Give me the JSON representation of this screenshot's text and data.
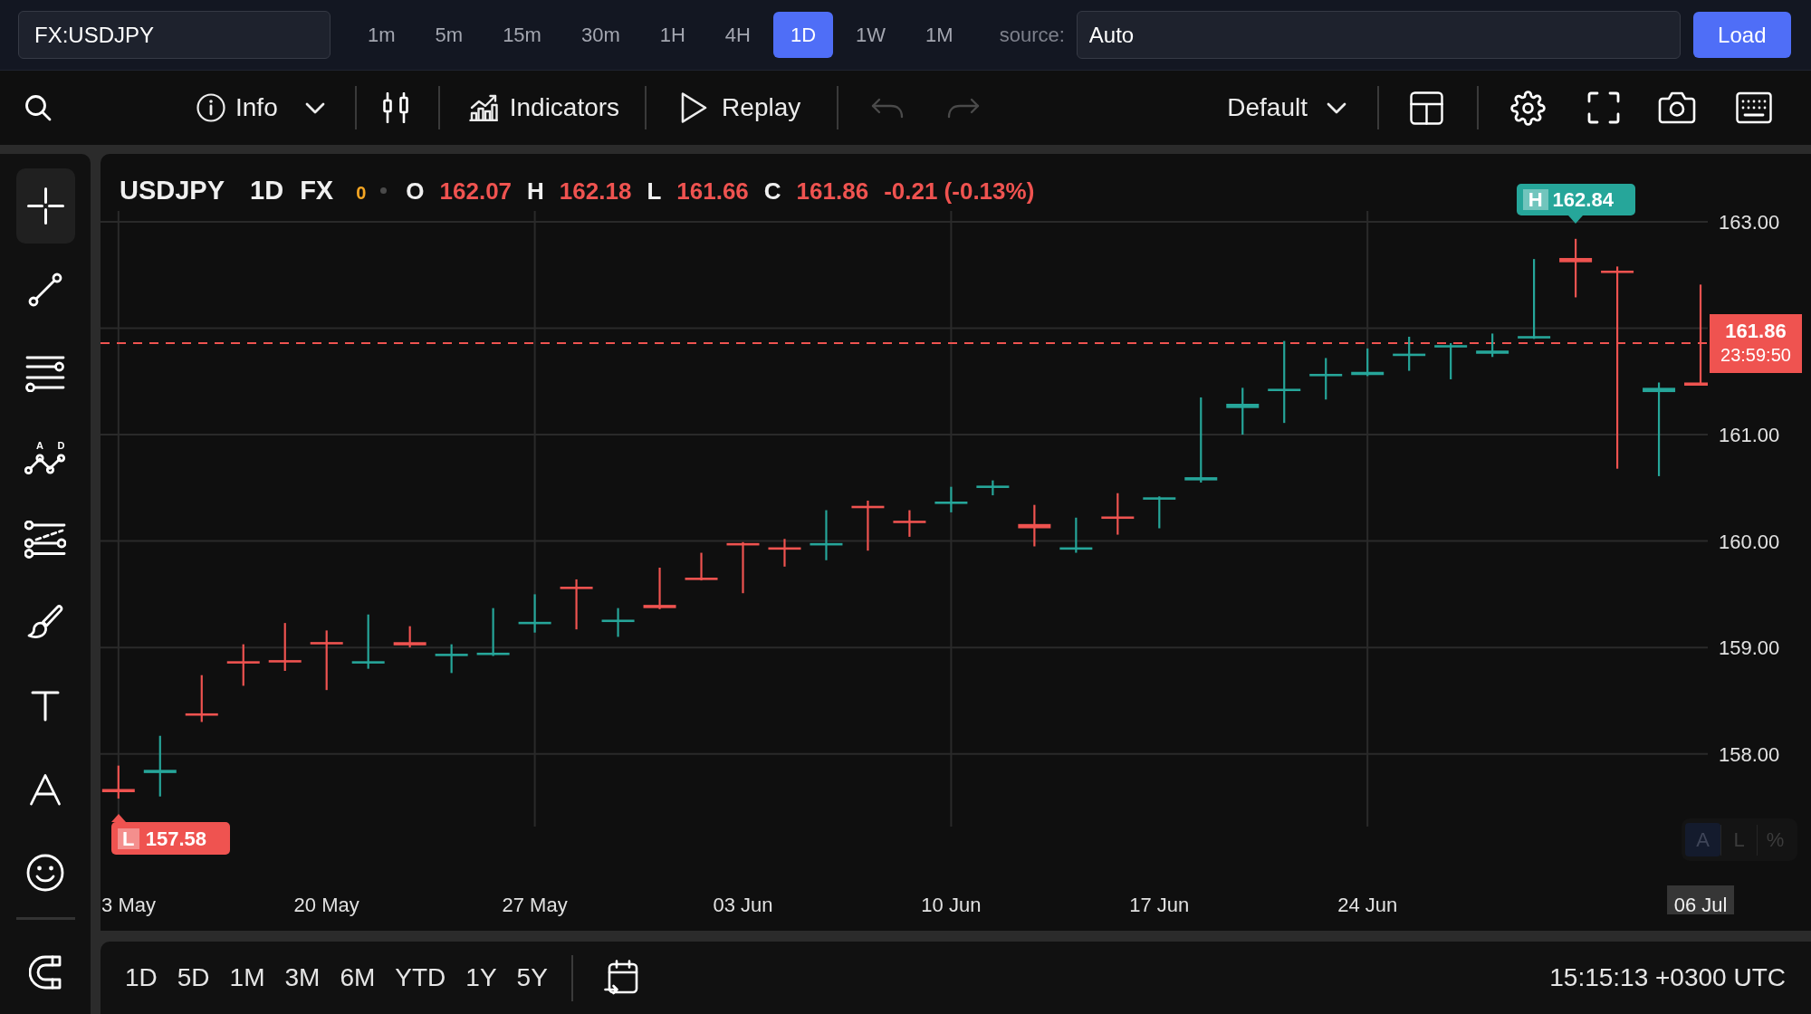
{
  "top_bar": {
    "symbol_field": {
      "value": "FX:USDJPY"
    },
    "timeframes": [
      {
        "label": "1m",
        "selected": false
      },
      {
        "label": "5m",
        "selected": false
      },
      {
        "label": "15m",
        "selected": false
      },
      {
        "label": "30m",
        "selected": false
      },
      {
        "label": "1H",
        "selected": false
      },
      {
        "label": "4H",
        "selected": false
      },
      {
        "label": "1D",
        "selected": true
      },
      {
        "label": "1W",
        "selected": false
      },
      {
        "label": "1M",
        "selected": false
      }
    ],
    "source_label": "source:",
    "source_field": {
      "value": "Auto"
    },
    "load_button": {
      "label": "Load"
    }
  },
  "toolbar": {
    "info_button": {
      "label": "Info"
    },
    "indicators_button": {
      "label": "Indicators"
    },
    "replay_button": {
      "label": "Replay"
    },
    "undo_button": {
      "disabled": true
    },
    "redo_button": {
      "disabled": true
    },
    "layout_menu": {
      "label": "Default"
    }
  },
  "drawing_tools": [
    {
      "kind": "crosshair",
      "selected": true
    },
    {
      "kind": "trend_line",
      "selected": false
    },
    {
      "kind": "horizontal_lines",
      "selected": false
    },
    {
      "kind": "pattern",
      "selected": false,
      "labels": [
        "A",
        "D"
      ]
    },
    {
      "kind": "fib_channel",
      "selected": false
    },
    {
      "kind": "brush",
      "selected": false
    },
    {
      "kind": "text",
      "selected": false
    },
    {
      "kind": "anchored_text",
      "selected": false
    },
    {
      "kind": "emoji",
      "selected": false
    }
  ],
  "bottom_tools": [
    {
      "kind": "magnet",
      "selected": false
    }
  ],
  "chart": {
    "legend": {
      "symbol": "USDJPY",
      "interval": "1D",
      "exchange": "FX",
      "indicator_count": "0",
      "values": [
        {
          "letter": "O",
          "value": "162.07"
        },
        {
          "letter": "H",
          "value": "162.18"
        },
        {
          "letter": "L",
          "value": "161.66"
        },
        {
          "letter": "C",
          "value": "161.86"
        }
      ],
      "change": "-0.21 (-0.13%)"
    },
    "price_axis": [
      "163.00",
      "161.00",
      "160.00",
      "159.00",
      "158.00"
    ],
    "date_axis": [
      "3 May",
      "20 May",
      "27 May",
      "03 Jun",
      "10 Jun",
      "17 Jun",
      "24 Jun"
    ],
    "current_date": "06 Jul",
    "high_marker": {
      "letter": "H",
      "value": "162.84"
    },
    "low_marker": {
      "letter": "L",
      "value": "157.58"
    },
    "last_price": {
      "value": "161.86",
      "countdown": "23:59:50"
    },
    "scale_modes": [
      {
        "label": "A",
        "selected": true
      },
      {
        "label": "L",
        "selected": false
      },
      {
        "label": "%",
        "selected": false
      }
    ]
  },
  "bottom_bar": {
    "ranges": [
      {
        "label": "1D",
        "selected": false
      },
      {
        "label": "5D",
        "selected": false
      },
      {
        "label": "1M",
        "selected": false
      },
      {
        "label": "3M",
        "selected": false
      },
      {
        "label": "6M",
        "selected": false
      },
      {
        "label": "YTD",
        "selected": false
      },
      {
        "label": "1Y",
        "selected": false
      },
      {
        "label": "5Y",
        "selected": false
      }
    ],
    "clock": "15:15:13 +0300 UTC"
  }
}
